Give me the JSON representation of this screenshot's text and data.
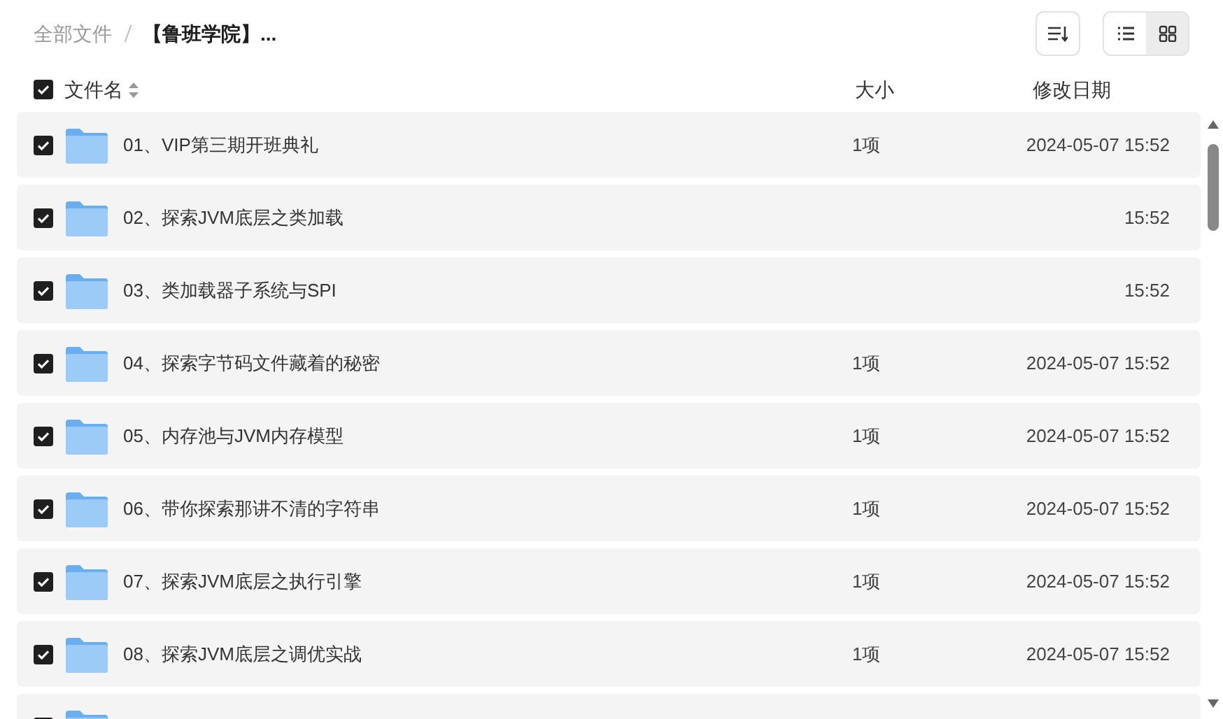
{
  "breadcrumb": [
    {
      "label": "全部文件",
      "current": false
    },
    {
      "label": "【鲁班学院】...",
      "current": true
    }
  ],
  "view_modes": [
    {
      "kind": "list",
      "selected": false
    },
    {
      "kind": "grid",
      "selected": true
    }
  ],
  "header": {
    "checked": true,
    "name": "文件名",
    "size": "大小",
    "date": "修改日期"
  },
  "rows": [
    {
      "checked": true,
      "name": "01、VIP第三期开班典礼",
      "size": "1项",
      "date": "2024-05-07 15:52"
    },
    {
      "checked": true,
      "name": "02、探索JVM底层之类加载",
      "date": "15:52"
    },
    {
      "checked": true,
      "name": "03、类加载器子系统与SPI",
      "date": "15:52"
    },
    {
      "checked": true,
      "name": "04、探索字节码文件藏着的秘密",
      "size": "1项",
      "date": "2024-05-07 15:52"
    },
    {
      "checked": true,
      "name": "05、内存池与JVM内存模型",
      "size": "1项",
      "date": "2024-05-07 15:52"
    },
    {
      "checked": true,
      "name": "06、带你探索那讲不清的字符串",
      "size": "1项",
      "date": "2024-05-07 15:52"
    },
    {
      "checked": true,
      "name": "07、探索JVM底层之执行引擎",
      "size": "1项",
      "date": "2024-05-07 15:52"
    },
    {
      "checked": true,
      "name": "08、探索JVM底层之调优实战",
      "size": "1项",
      "date": "2024-05-07 15:52"
    },
    {
      "checked": true
    }
  ]
}
